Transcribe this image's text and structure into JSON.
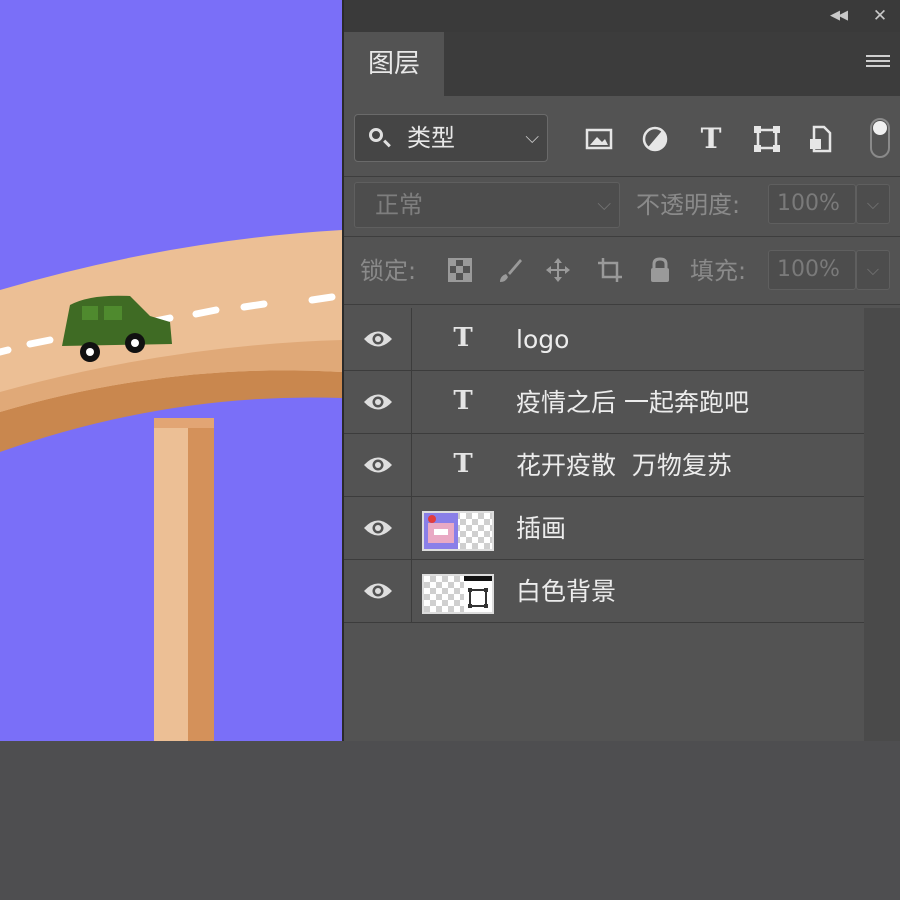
{
  "panel": {
    "tab_label": "图层",
    "filter": {
      "label": "类型",
      "icons": [
        "image-filter-icon",
        "adjustment-filter-icon",
        "type-filter-icon",
        "shape-filter-icon",
        "smart-object-filter-icon"
      ]
    },
    "blend_mode": "正常",
    "opacity_label": "不透明度:",
    "opacity_value": "100%",
    "lock_label": "锁定:",
    "fill_label": "填充:",
    "fill_value": "100%"
  },
  "layers": [
    {
      "name": "logo",
      "kind": "text"
    },
    {
      "name": "疫情之后 一起奔跑吧",
      "kind": "text"
    },
    {
      "name": "花开疫散  万物复苏",
      "kind": "text"
    },
    {
      "name": "插画",
      "kind": "image"
    },
    {
      "name": "白色背景",
      "kind": "shape"
    }
  ],
  "colors": {
    "canvas_bg": "#7a6ff8",
    "panel_bg": "#535353",
    "road": "#ecbf95",
    "car": "#3f6b24"
  }
}
